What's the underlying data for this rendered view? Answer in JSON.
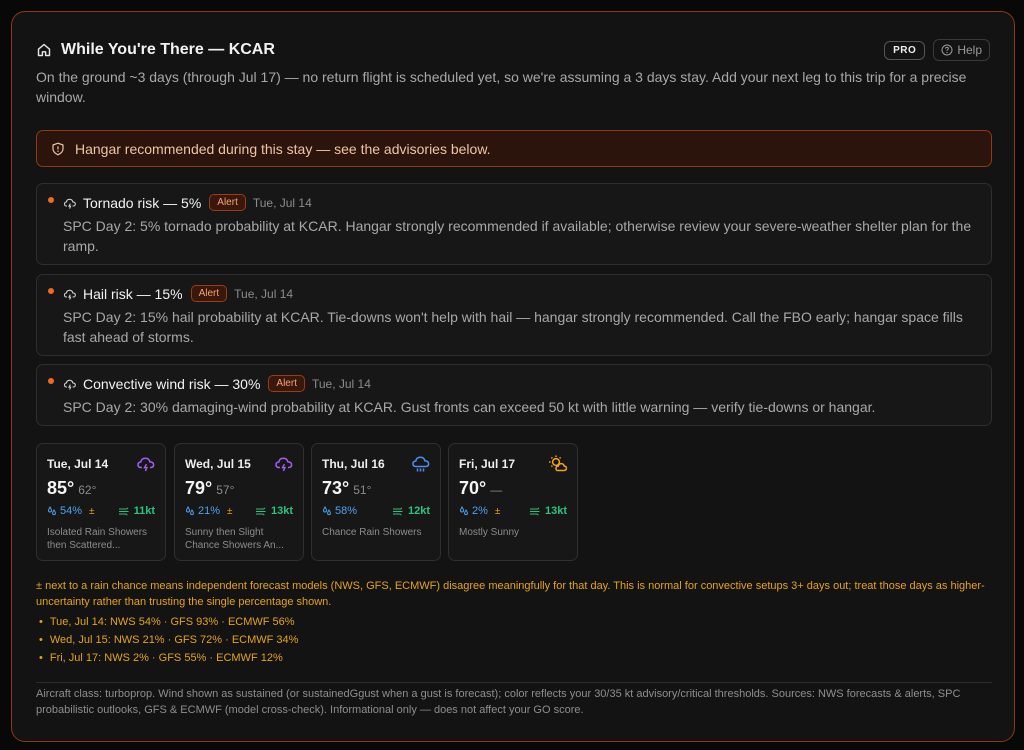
{
  "header": {
    "title": "While You're There — KCAR",
    "pro_label": "PRO",
    "help_label": "Help",
    "home_icon": "home-icon",
    "help_icon": "question-circle-icon"
  },
  "subtitle": "On the ground ~3 days (through Jul 17) — no return flight is scheduled yet, so we're assuming a 3 days stay. Add your next leg to this trip for a precise window.",
  "banner": {
    "text": "Hangar recommended during this stay — see the advisories below.",
    "icon": "shield-alert-icon"
  },
  "advisories": [
    {
      "title": "Tornado risk — 5%",
      "badge": "Alert",
      "date": "Tue, Jul 14",
      "body": "SPC Day 2: 5% tornado probability at KCAR. Hangar strongly recommended if available; otherwise review your severe-weather shelter plan for the ramp."
    },
    {
      "title": "Hail risk — 15%",
      "badge": "Alert",
      "date": "Tue, Jul 14",
      "body": "SPC Day 2: 15% hail probability at KCAR. Tie-downs won't help with hail — hangar strongly recommended. Call the FBO early; hangar space fills fast ahead of storms."
    },
    {
      "title": "Convective wind risk — 30%",
      "badge": "Alert",
      "date": "Tue, Jul 14",
      "body": "SPC Day 2: 30% damaging-wind probability at KCAR. Gust fronts can exceed 50 kt with little warning — verify tie-downs or hangar."
    }
  ],
  "forecast": [
    {
      "day": "Tue, Jul 14",
      "high": "85°",
      "low": "62°",
      "rain": "54%",
      "uncertain": "±",
      "wind": "11kt",
      "desc": "Isolated Rain Showers then Scattered...",
      "icon": "thunderstorm-icon"
    },
    {
      "day": "Wed, Jul 15",
      "high": "79°",
      "low": "57°",
      "rain": "21%",
      "uncertain": "±",
      "wind": "13kt",
      "desc": "Sunny then Slight Chance Showers An...",
      "icon": "thunderstorm-icon"
    },
    {
      "day": "Thu, Jul 16",
      "high": "73°",
      "low": "51°",
      "rain": "58%",
      "uncertain": "",
      "wind": "12kt",
      "desc": "Chance Rain Showers",
      "icon": "rain-cloud-icon"
    },
    {
      "day": "Fri, Jul 17",
      "high": "70°",
      "low": "—",
      "rain": "2%",
      "uncertain": "±",
      "wind": "13kt",
      "desc": "Mostly Sunny",
      "icon": "sun-cloud-icon"
    }
  ],
  "uncertainty_note": "± next to a rain chance means independent forecast models (NWS, GFS, ECMWF) disagree meaningfully for that day. This is normal for convective setups 3+ days out; treat those days as higher-uncertainty rather than trusting the single percentage shown.",
  "model_lines": [
    "Tue, Jul 14: NWS 54% · GFS 93% · ECMWF 56%",
    "Wed, Jul 15: NWS 21% · GFS 72% · ECMWF 34%",
    "Fri, Jul 17: NWS 2% · GFS 55% · ECMWF 12%"
  ],
  "footer": "Aircraft class: turboprop. Wind shown as sustained (or sustainedGgust when a gust is forecast); color reflects your 30/35 kt advisory/critical thresholds. Sources: NWS forecasts & alerts, SPC probabilistic outlooks, GFS & ECMWF (model cross-check). Informational only — does not affect your GO score.",
  "colors": {
    "accent_orange": "#f26a1b",
    "rain_blue": "#4da3f0",
    "wind_green": "#2ec27e",
    "uncertainty_amber": "#e6a21b",
    "storm_purple": "#a35ef0"
  }
}
